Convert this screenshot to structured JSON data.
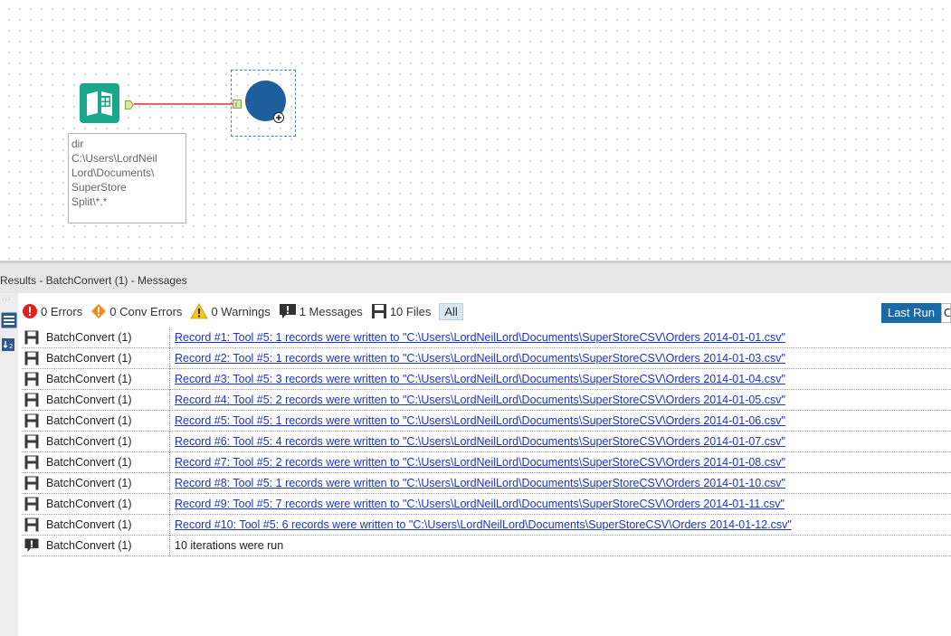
{
  "canvas": {
    "annotation": "dir\nC:\\Users\\LordNeil\nLord\\Documents\\\nSuperStore\nSplit\\*.*",
    "anchor_label": "I"
  },
  "results": {
    "title": "Results - BatchConvert (1) - Messages",
    "filters": {
      "errors": "0 Errors",
      "conv_errors": "0 Conv Errors",
      "warnings": "0 Warnings",
      "messages": "1 Messages",
      "files": "10 Files",
      "all": "All"
    },
    "last_run": "Last Run",
    "last_run_extra": "C",
    "rows": [
      {
        "tool": "BatchConvert (1)",
        "message": "Record #1: Tool #5: 1 records were written to \"C:\\Users\\LordNeilLord\\Documents\\SuperStoreCSV\\Orders 2014-01-01.csv\""
      },
      {
        "tool": "BatchConvert (1)",
        "message": "Record #2: Tool #5: 1 records were written to \"C:\\Users\\LordNeilLord\\Documents\\SuperStoreCSV\\Orders 2014-01-03.csv\""
      },
      {
        "tool": "BatchConvert (1)",
        "message": "Record #3: Tool #5: 3 records were written to \"C:\\Users\\LordNeilLord\\Documents\\SuperStoreCSV\\Orders 2014-01-04.csv\""
      },
      {
        "tool": "BatchConvert (1)",
        "message": "Record #4: Tool #5: 2 records were written to \"C:\\Users\\LordNeilLord\\Documents\\SuperStoreCSV\\Orders 2014-01-05.csv\""
      },
      {
        "tool": "BatchConvert (1)",
        "message": "Record #5: Tool #5: 1 records were written to \"C:\\Users\\LordNeilLord\\Documents\\SuperStoreCSV\\Orders 2014-01-06.csv\""
      },
      {
        "tool": "BatchConvert (1)",
        "message": "Record #6: Tool #5: 4 records were written to \"C:\\Users\\LordNeilLord\\Documents\\SuperStoreCSV\\Orders 2014-01-07.csv\""
      },
      {
        "tool": "BatchConvert (1)",
        "message": "Record #7: Tool #5: 2 records were written to \"C:\\Users\\LordNeilLord\\Documents\\SuperStoreCSV\\Orders 2014-01-08.csv\""
      },
      {
        "tool": "BatchConvert (1)",
        "message": "Record #8: Tool #5: 1 records were written to \"C:\\Users\\LordNeilLord\\Documents\\SuperStoreCSV\\Orders 2014-01-10.csv\""
      },
      {
        "tool": "BatchConvert (1)",
        "message": "Record #9: Tool #5: 7 records were written to \"C:\\Users\\LordNeilLord\\Documents\\SuperStoreCSV\\Orders 2014-01-11.csv\""
      },
      {
        "tool": "BatchConvert (1)",
        "message": "Record #10: Tool #5: 6 records were written to \"C:\\Users\\LordNeilLord\\Documents\\SuperStoreCSV\\Orders 2014-01-12.csv\""
      },
      {
        "tool": "BatchConvert (1)",
        "message": "10 iterations were run"
      }
    ]
  },
  "colors": {
    "tool_green": "#1aa68a",
    "macro_blue": "#1d5e9c",
    "connector_red": "#e03030",
    "link_blue": "#1a33cc",
    "last_run_bg": "#1a6aa8"
  }
}
